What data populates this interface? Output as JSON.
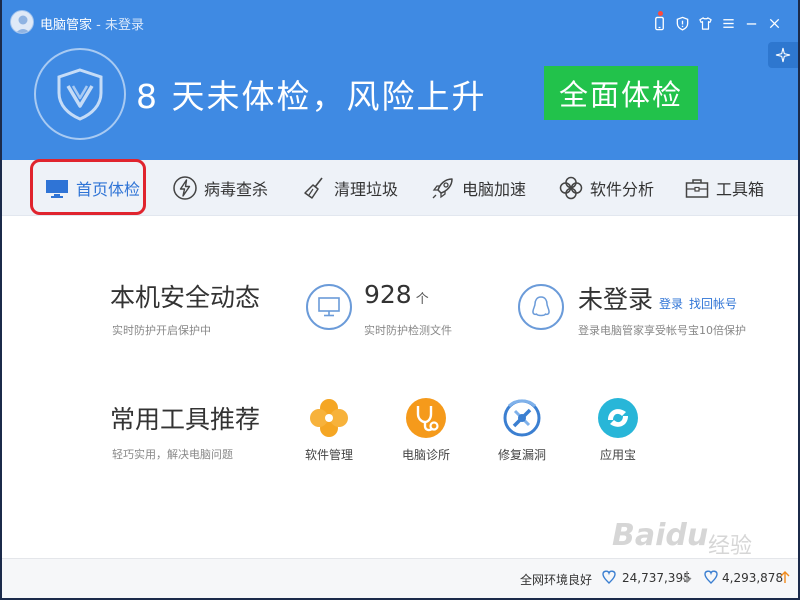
{
  "titlebar": {
    "app_name": "电脑管家",
    "login_status": " - 未登录"
  },
  "banner": {
    "risk_message": "8 天未体检，风险上升",
    "scan_button": "全面体检"
  },
  "nav": [
    {
      "label": "首页体检",
      "icon": "monitor-icon",
      "active": true
    },
    {
      "label": "病毒查杀",
      "icon": "lightning-icon"
    },
    {
      "label": "清理垃圾",
      "icon": "broom-icon"
    },
    {
      "label": "电脑加速",
      "icon": "rocket-icon"
    },
    {
      "label": "软件分析",
      "icon": "clover-icon"
    },
    {
      "label": "工具箱",
      "icon": "toolbox-icon"
    }
  ],
  "security": {
    "title": "本机安全动态",
    "subtitle": "实时防护开启保护中",
    "file_count": "928",
    "file_unit": "个",
    "file_label": "实时防护检测文件",
    "account_title": "未登录",
    "login_link": "登录",
    "recover_link": "找回帐号",
    "account_desc": "登录电脑管家享受帐号宝10倍保护"
  },
  "tools": {
    "title": "常用工具推荐",
    "subtitle": "轻巧实用，解决电脑问题",
    "items": [
      {
        "label": "软件管理",
        "icon": "software-manager-icon"
      },
      {
        "label": "电脑诊所",
        "icon": "stethoscope-icon"
      },
      {
        "label": "修复漏洞",
        "icon": "patch-icon"
      },
      {
        "label": "应用宝",
        "icon": "app-store-icon"
      }
    ]
  },
  "statusbar": {
    "network": "全网环境良好",
    "stat1": "24,737,395",
    "stat2": "4,293,878"
  },
  "watermark": {
    "brand": "Baidu",
    "cn": "经验"
  },
  "colors": {
    "banner": "#3f8ae3",
    "accent_green": "#22c24b",
    "link_blue": "#2f74d6",
    "highlight_red": "#e0242e"
  }
}
